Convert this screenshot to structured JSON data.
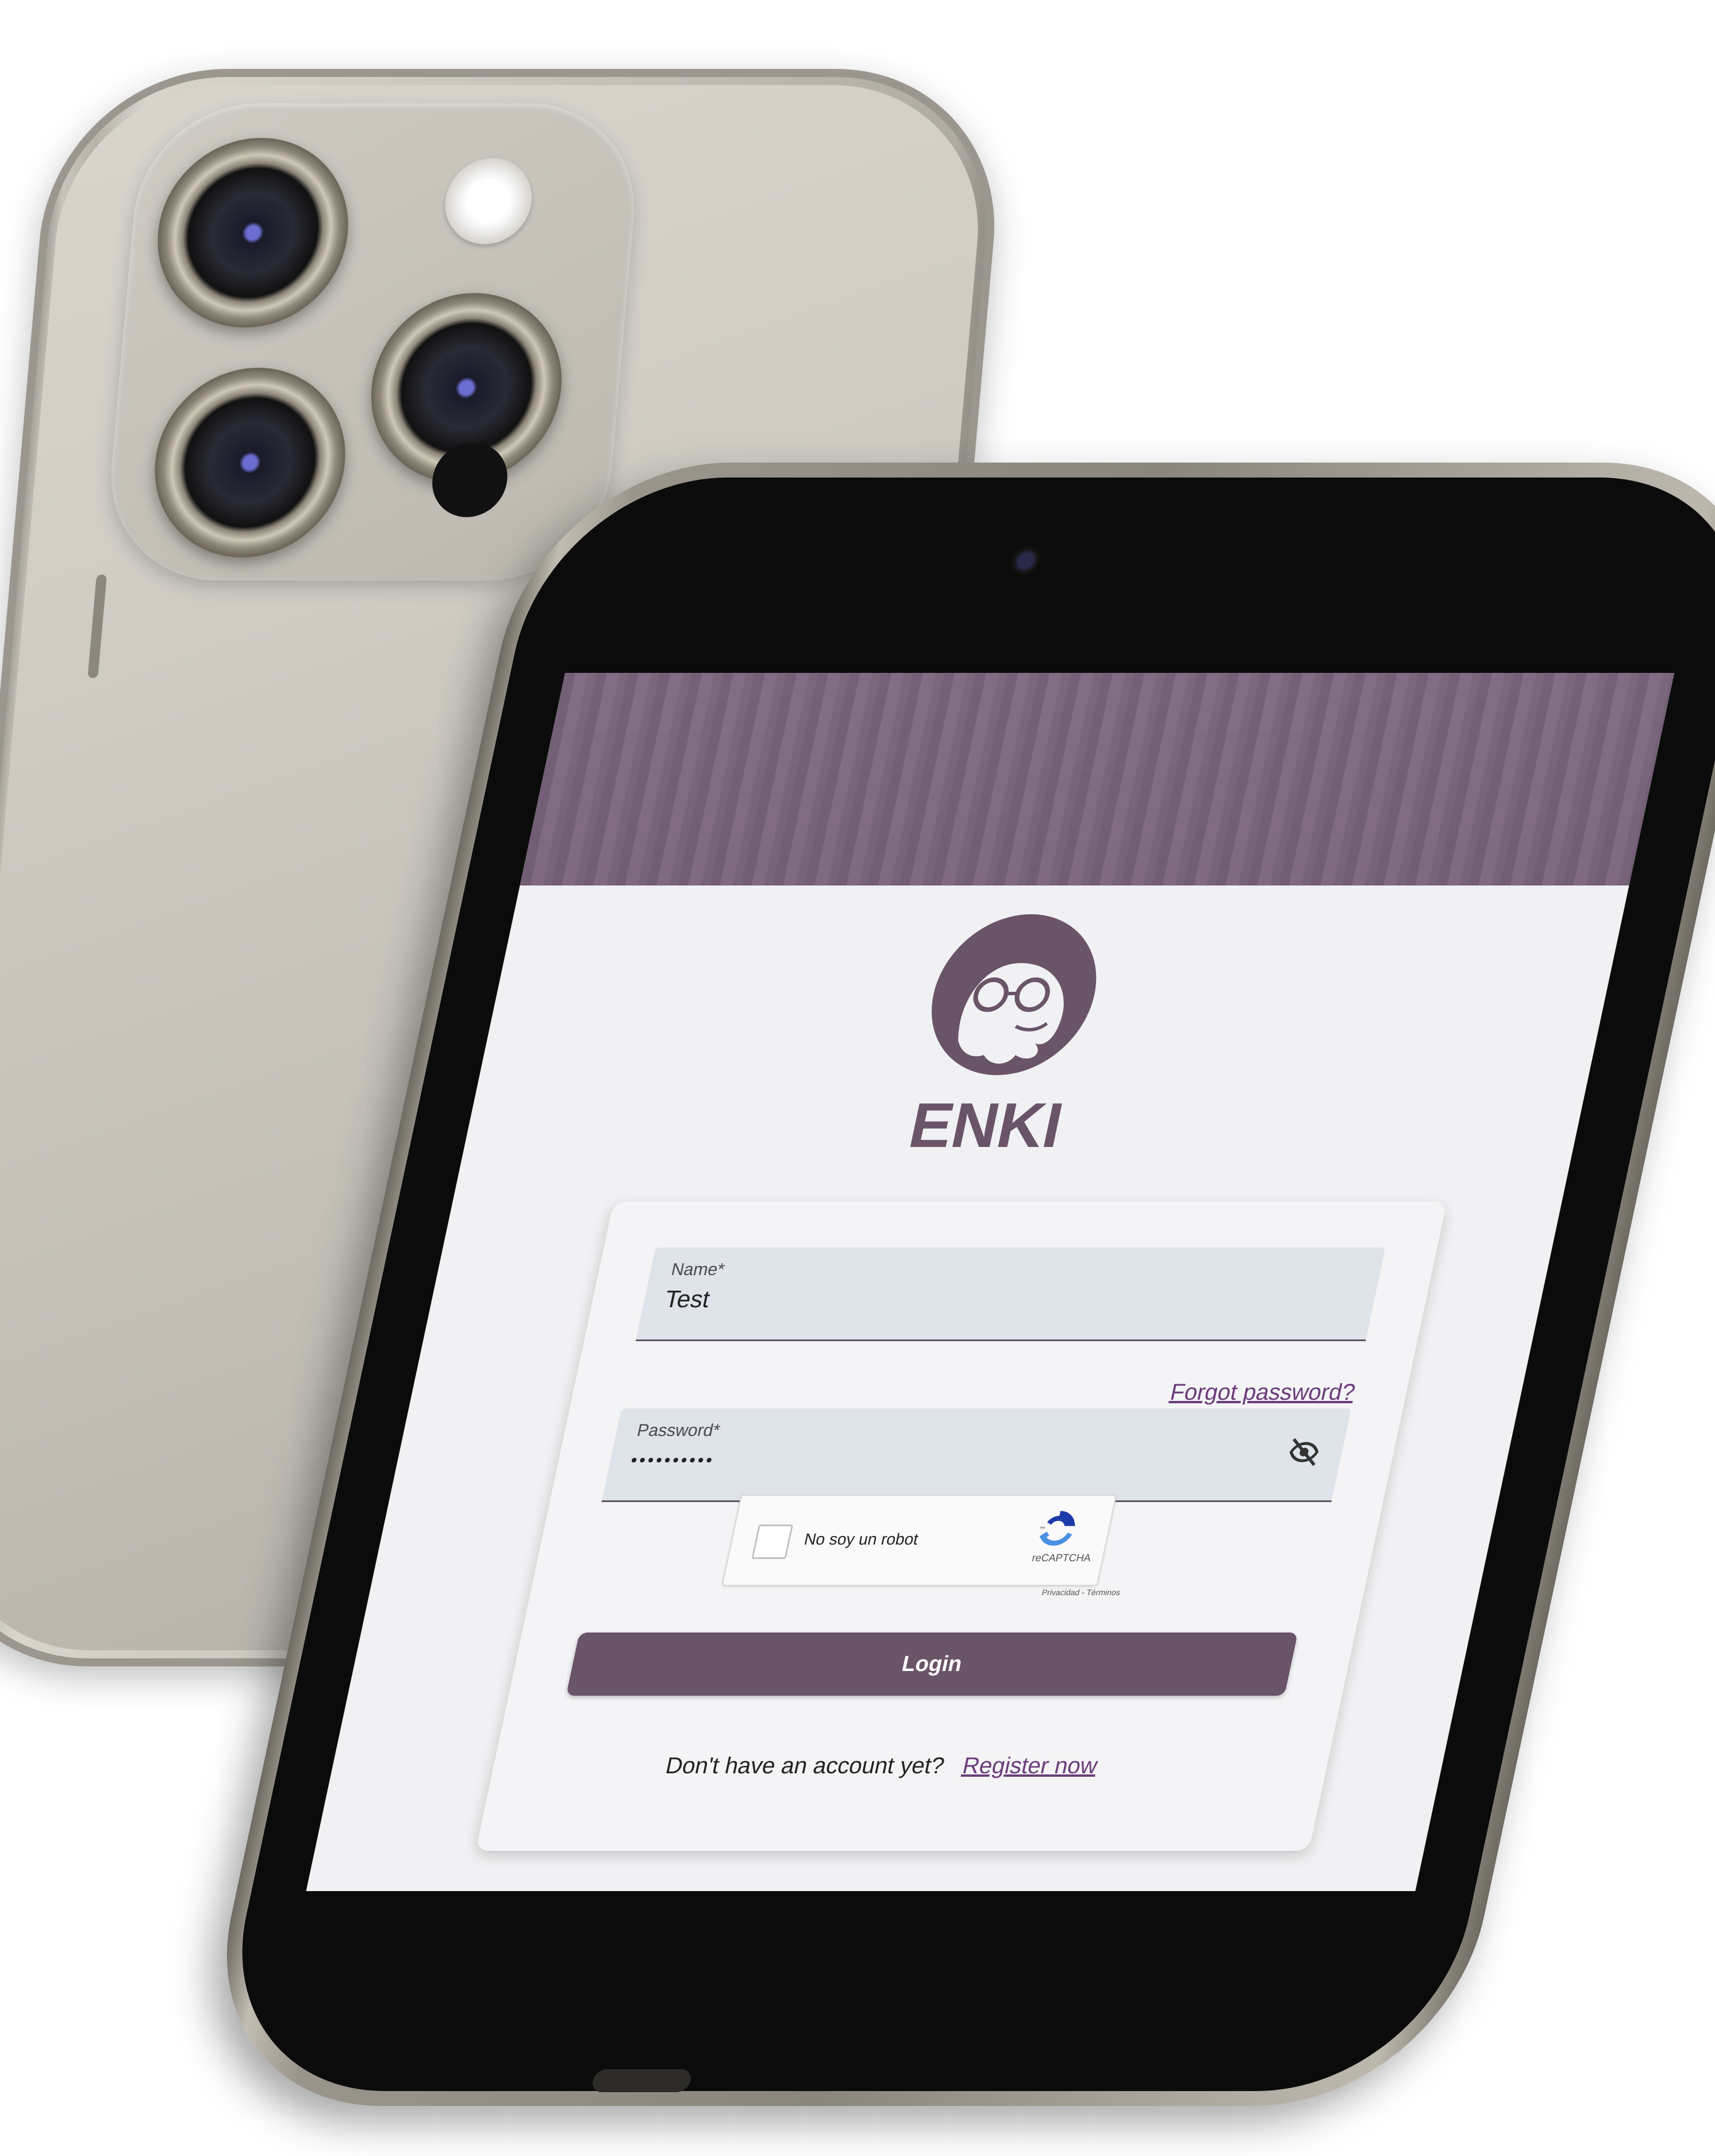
{
  "app": {
    "logo_text": "ENKI"
  },
  "login_form": {
    "name_label": "Name*",
    "name_value": "Test",
    "forgot_password_link": "Forgot password?",
    "password_label": "Password*",
    "password_value": "••••••••••",
    "password_toggle_icon": "eye-off-icon",
    "recaptcha": {
      "checkbox_label": "No soy un robot",
      "brand": "reCAPTCHA",
      "terms": "Privacidad - Términos"
    },
    "login_button": "Login",
    "register_prompt": "Don't have an account yet?",
    "register_link": "Register now"
  },
  "colors": {
    "primary": "#6a5468",
    "link": "#6b3d7a",
    "logo": "#6a5468"
  }
}
